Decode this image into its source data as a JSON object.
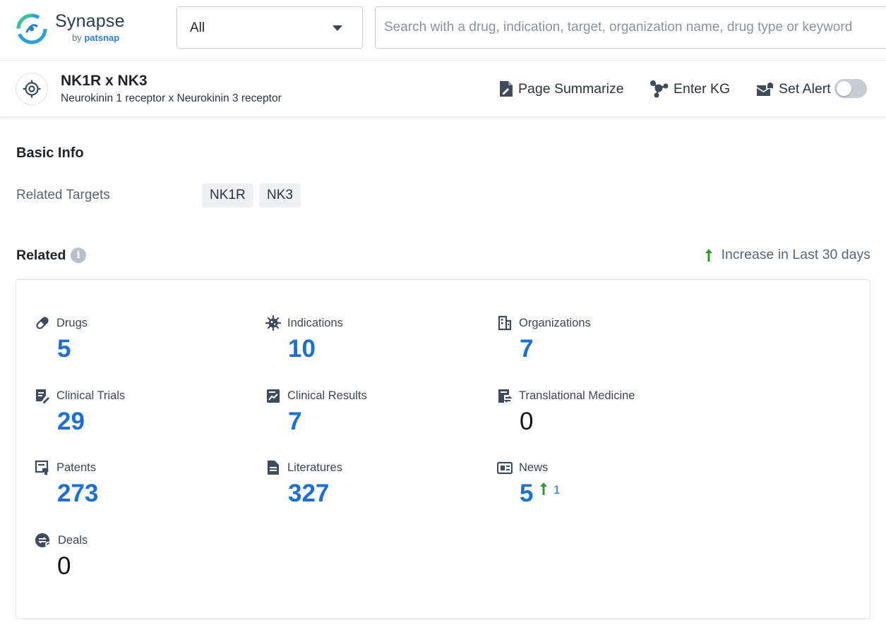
{
  "brand": {
    "name": "Synapse",
    "by_prefix": "by",
    "by_name": "patsnap"
  },
  "search": {
    "scope_value": "All",
    "placeholder": "Search with a drug, indication, target, organization name, drug type or keyword"
  },
  "entity": {
    "title": "NK1R x NK3",
    "subtitle": "Neurokinin 1 receptor x Neurokinin 3 receptor",
    "actions": {
      "summarize": "Page Summarize",
      "kg": "Enter KG",
      "alert": "Set Alert"
    },
    "alert_enabled": false
  },
  "basic_info": {
    "title": "Basic Info",
    "related_targets_label": "Related Targets",
    "related_targets": [
      "NK1R",
      "NK3"
    ]
  },
  "related": {
    "title": "Related",
    "increase_note": "Increase in Last 30 days",
    "stats": [
      {
        "label": "Drugs",
        "icon": "pill-icon",
        "value": "5"
      },
      {
        "label": "Indications",
        "icon": "virus-icon",
        "value": "10"
      },
      {
        "label": "Organizations",
        "icon": "building-icon",
        "value": "7"
      },
      {
        "label": "Clinical Trials",
        "icon": "clipboard-edit-icon",
        "value": "29"
      },
      {
        "label": "Clinical Results",
        "icon": "chart-report-icon",
        "value": "7"
      },
      {
        "label": "Translational Medicine",
        "icon": "transfer-doc-icon",
        "value": "0"
      },
      {
        "label": "Patents",
        "icon": "certificate-icon",
        "value": "273"
      },
      {
        "label": "Literatures",
        "icon": "document-icon",
        "value": "327"
      },
      {
        "label": "News",
        "icon": "newspaper-icon",
        "value": "5",
        "increase": "1"
      },
      {
        "label": "Deals",
        "icon": "handshake-icon",
        "value": "0"
      }
    ]
  },
  "colors": {
    "accent": "#1d6fd1",
    "increase": "#2f9a2f",
    "icon": "#3f4a5a"
  }
}
